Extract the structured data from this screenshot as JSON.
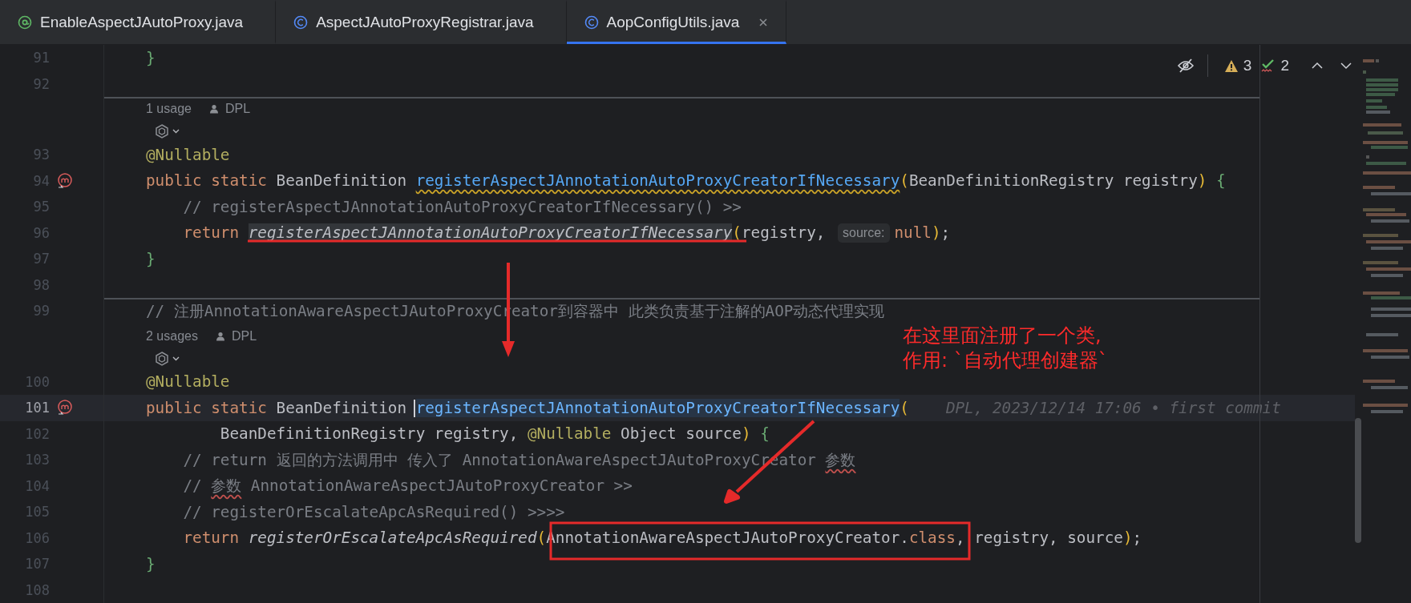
{
  "tabs": [
    {
      "label": "EnableAspectJAutoProxy.java",
      "kind": "annotation",
      "selected": false
    },
    {
      "label": "AspectJAutoProxyRegistrar.java",
      "kind": "class",
      "selected": false
    },
    {
      "label": "AopConfigUtils.java",
      "kind": "class",
      "selected": true
    }
  ],
  "inspections": {
    "warnings": "3",
    "checks": "2"
  },
  "rows": [
    {
      "kind": "code",
      "number": "91",
      "marker": false,
      "current": false,
      "parts": [
        {
          "kind": "code",
          "tokens": [
            {
              "text": "}",
              "kind": "brace"
            }
          ]
        }
      ]
    },
    {
      "kind": "code",
      "number": "92",
      "marker": false,
      "current": false,
      "parts": []
    },
    {
      "kind": "usages",
      "separator_above": true,
      "usages": "1 usage",
      "author": "DPL"
    },
    {
      "kind": "vision"
    },
    {
      "kind": "code",
      "number": "93",
      "marker": false,
      "current": false,
      "parts": [
        {
          "kind": "code",
          "tokens": [
            {
              "text": "@Nullable",
              "kind": "annotation"
            }
          ]
        }
      ]
    },
    {
      "kind": "code",
      "number": "94",
      "marker": true,
      "current": false,
      "parts": [
        {
          "kind": "code",
          "tokens": [
            {
              "text": "public static ",
              "kind": "keyword",
              "warning": false
            },
            {
              "text": "BeanDefinition ",
              "kind": "plain",
              "warning": false
            },
            {
              "text": "registerAspectJAnnotationAutoProxyCreatorIfNecessary",
              "kind": "declaration",
              "warning": true
            },
            {
              "text": "(",
              "kind": "paren",
              "warning": false
            },
            {
              "text": "BeanDefinitionRegistry registry",
              "kind": "plain",
              "warning": false
            },
            {
              "text": ")",
              "kind": "paren",
              "warning": false
            },
            {
              "text": " {",
              "kind": "brace",
              "warning": false
            }
          ]
        }
      ]
    },
    {
      "kind": "code",
      "number": "95",
      "marker": false,
      "current": false,
      "parts": [
        {
          "kind": "code",
          "tokens": [
            {
              "text": "    // registerAspectJAnnotationAutoProxyCreatorIfNecessary() >>",
              "kind": "comment"
            }
          ]
        }
      ]
    },
    {
      "kind": "code",
      "number": "96",
      "marker": false,
      "current": false,
      "parts": [
        {
          "kind": "code",
          "tokens": [
            {
              "text": "    return ",
              "kind": "keyword",
              "highlight": false
            },
            {
              "text": "registerAspectJAnnotationAutoProxyCreatorIfNecessary",
              "kind": "call",
              "highlight": true
            },
            {
              "text": "(",
              "kind": "paren",
              "highlight": false
            },
            {
              "text": "registry, ",
              "kind": "plain",
              "highlight": false
            }
          ]
        },
        {
          "kind": "hint",
          "text": "source:"
        },
        {
          "kind": "code",
          "tokens": [
            {
              "text": "null",
              "kind": "keyword"
            },
            {
              "text": ")",
              "kind": "paren"
            },
            {
              "text": ";",
              "kind": "plain"
            }
          ]
        }
      ]
    },
    {
      "kind": "code",
      "number": "97",
      "marker": false,
      "current": false,
      "parts": [
        {
          "kind": "code",
          "tokens": [
            {
              "text": "}",
              "kind": "brace"
            }
          ]
        }
      ]
    },
    {
      "kind": "code",
      "number": "98",
      "marker": false,
      "current": false,
      "parts": []
    },
    {
      "kind": "code",
      "number": "99",
      "marker": false,
      "current": false,
      "separator_above": true,
      "parts": [
        {
          "kind": "code",
          "tokens": [
            {
              "text": "// 注册AnnotationAwareAspectJAutoProxyCreator到容器中 此类负责基于注解的AOP动态代理实现",
              "kind": "comment"
            }
          ]
        }
      ]
    },
    {
      "kind": "usages",
      "separator_above": false,
      "usages": "2 usages",
      "author": "DPL"
    },
    {
      "kind": "vision"
    },
    {
      "kind": "code",
      "number": "100",
      "marker": false,
      "current": false,
      "parts": [
        {
          "kind": "code",
          "tokens": [
            {
              "text": "@Nullable",
              "kind": "annotation"
            }
          ]
        }
      ]
    },
    {
      "kind": "code",
      "number": "101",
      "marker": true,
      "current": true,
      "parts": [
        {
          "kind": "code",
          "tokens": [
            {
              "text": "public static ",
              "kind": "keyword",
              "highlight": false,
              "caret": false
            },
            {
              "text": "BeanDefinition ",
              "kind": "plain",
              "highlight": false,
              "caret": false
            },
            {
              "text": "registerAspectJAnnotationAutoProxyCreatorIfNecessary",
              "kind": "declaration",
              "highlight": true,
              "caret": true
            },
            {
              "text": "(",
              "kind": "paren",
              "highlight": false,
              "caret": false
            }
          ]
        },
        {
          "kind": "blame",
          "text": "DPL, 2023/12/14 17:06 • first commit"
        }
      ]
    },
    {
      "kind": "code",
      "number": "102",
      "marker": false,
      "current": false,
      "parts": [
        {
          "kind": "code",
          "tokens": [
            {
              "text": "        BeanDefinitionRegistry registry, ",
              "kind": "plain"
            },
            {
              "text": "@Nullable",
              "kind": "annotation"
            },
            {
              "text": " Object source",
              "kind": "plain"
            },
            {
              "text": ")",
              "kind": "paren"
            },
            {
              "text": " {",
              "kind": "brace"
            }
          ]
        }
      ]
    },
    {
      "kind": "code",
      "number": "103",
      "marker": false,
      "current": false,
      "parts": [
        {
          "kind": "code",
          "tokens": [
            {
              "text": "    // return 返回的方法调用中 传入了 AnnotationAwareAspectJAutoProxyCreator ",
              "kind": "comment"
            },
            {
              "text": "参数",
              "kind": "typo"
            }
          ]
        }
      ]
    },
    {
      "kind": "code",
      "number": "104",
      "marker": false,
      "current": false,
      "parts": [
        {
          "kind": "code",
          "tokens": [
            {
              "text": "    // ",
              "kind": "comment"
            },
            {
              "text": "参数",
              "kind": "typo"
            },
            {
              "text": " AnnotationAwareAspectJAutoProxyCreator >>",
              "kind": "comment"
            }
          ]
        }
      ]
    },
    {
      "kind": "code",
      "number": "105",
      "marker": false,
      "current": false,
      "parts": [
        {
          "kind": "code",
          "tokens": [
            {
              "text": "    // registerOrEscalateApcAsRequired() >>>>",
              "kind": "comment"
            }
          ]
        }
      ]
    },
    {
      "kind": "code",
      "number": "106",
      "marker": false,
      "current": false,
      "parts": [
        {
          "kind": "code",
          "tokens": [
            {
              "text": "    return ",
              "kind": "keyword"
            },
            {
              "text": "registerOrEscalateApcAsRequired",
              "kind": "call"
            },
            {
              "text": "(",
              "kind": "paren"
            },
            {
              "text": "AnnotationAwareAspectJAutoProxyCreator.",
              "kind": "plain"
            },
            {
              "text": "class",
              "kind": "keyword"
            },
            {
              "text": ", registry, source",
              "kind": "plain"
            },
            {
              "text": ")",
              "kind": "paren"
            },
            {
              "text": ";",
              "kind": "plain"
            }
          ]
        }
      ]
    },
    {
      "kind": "code",
      "number": "107",
      "marker": false,
      "current": false,
      "parts": [
        {
          "kind": "code",
          "tokens": [
            {
              "text": "}",
              "kind": "brace"
            }
          ]
        }
      ]
    },
    {
      "kind": "code",
      "number": "108",
      "marker": false,
      "current": false,
      "parts": []
    }
  ],
  "note": {
    "lines": [
      "在这里面注册了一个类,",
      "作用: `自动代理创建器`"
    ]
  }
}
